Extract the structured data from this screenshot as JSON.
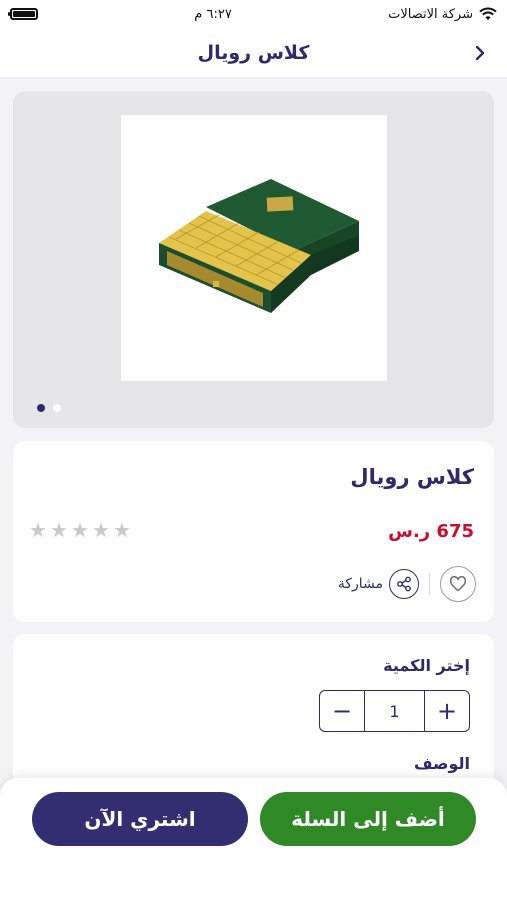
{
  "status_bar": {
    "carrier": "شركة الاتصالات",
    "time": "٦:٢٧ م"
  },
  "header": {
    "title": "كلاس رويال",
    "back_icon": "chevron-right-icon"
  },
  "gallery": {
    "image_alt": "product-photo",
    "dots_count": 2,
    "active_index": 0
  },
  "product": {
    "name": "كلاس رويال",
    "price": "675 ر.س",
    "rating": 0,
    "rating_max": 5,
    "share_label": "مشاركة"
  },
  "quantity": {
    "label": "إختر الكمية",
    "value": "1",
    "minus": "−",
    "plus": "+"
  },
  "description": {
    "label": "الوصف"
  },
  "buttons": {
    "add_to_cart": "أضف إلى السلة",
    "buy_now": "اشتري الآن"
  },
  "colors": {
    "brand_purple": "#2f2a6b",
    "price_red": "#c8102e",
    "cart_green": "#2f8a25",
    "buy_purple": "#332e72"
  }
}
